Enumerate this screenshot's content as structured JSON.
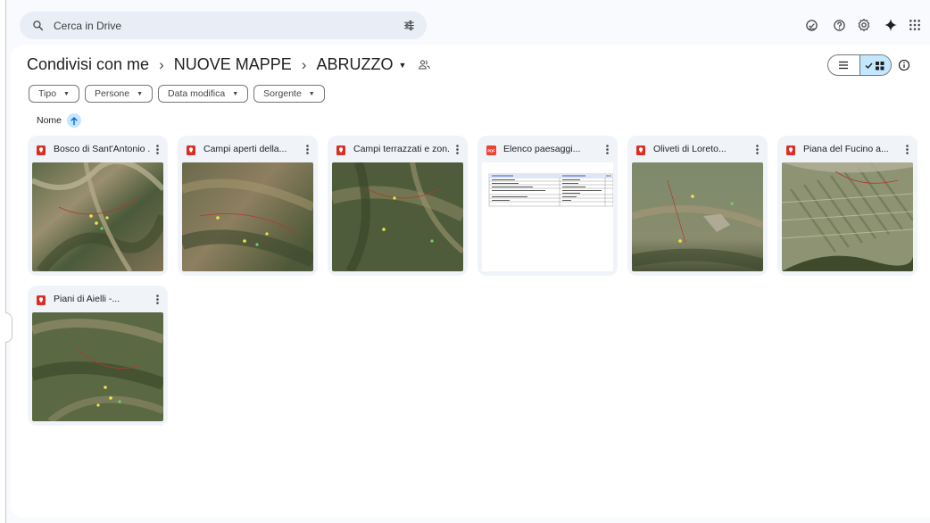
{
  "search": {
    "placeholder": "Cerca in Drive"
  },
  "breadcrumb": {
    "root": "Condivisi con me",
    "separator": "›",
    "level1": "NUOVE MAPPE",
    "current": "ABRUZZO"
  },
  "filters": [
    {
      "label": "Tipo"
    },
    {
      "label": "Persone"
    },
    {
      "label": "Data modifica"
    },
    {
      "label": "Sorgente"
    }
  ],
  "sort": {
    "label": "Nome",
    "direction": "ascending"
  },
  "files": [
    {
      "title": "Bosco di Sant'Antonio ...",
      "type": "kml-icon",
      "thumb": "map"
    },
    {
      "title": "Campi aperti della...",
      "type": "kml-icon",
      "thumb": "map"
    },
    {
      "title": "Campi terrazzati e zon...",
      "type": "kml-icon",
      "thumb": "map"
    },
    {
      "title": "Elenco paesaggi...",
      "type": "pdf-icon",
      "thumb": "document",
      "badge": "PDF"
    },
    {
      "title": "Oliveti di Loreto...",
      "type": "kml-icon",
      "thumb": "map"
    },
    {
      "title": "Piana del Fucino a...",
      "type": "kml-icon",
      "thumb": "map"
    },
    {
      "title": "Piani di Aielli -...",
      "type": "kml-icon",
      "thumb": "map"
    }
  ],
  "view": {
    "mode": "grid"
  },
  "colors": {
    "accent": "#c2e7ff",
    "kml": "#d93025",
    "pdf": "#ea4335",
    "card_bg": "#f0f4f9",
    "search_bg": "#e9eef6"
  }
}
